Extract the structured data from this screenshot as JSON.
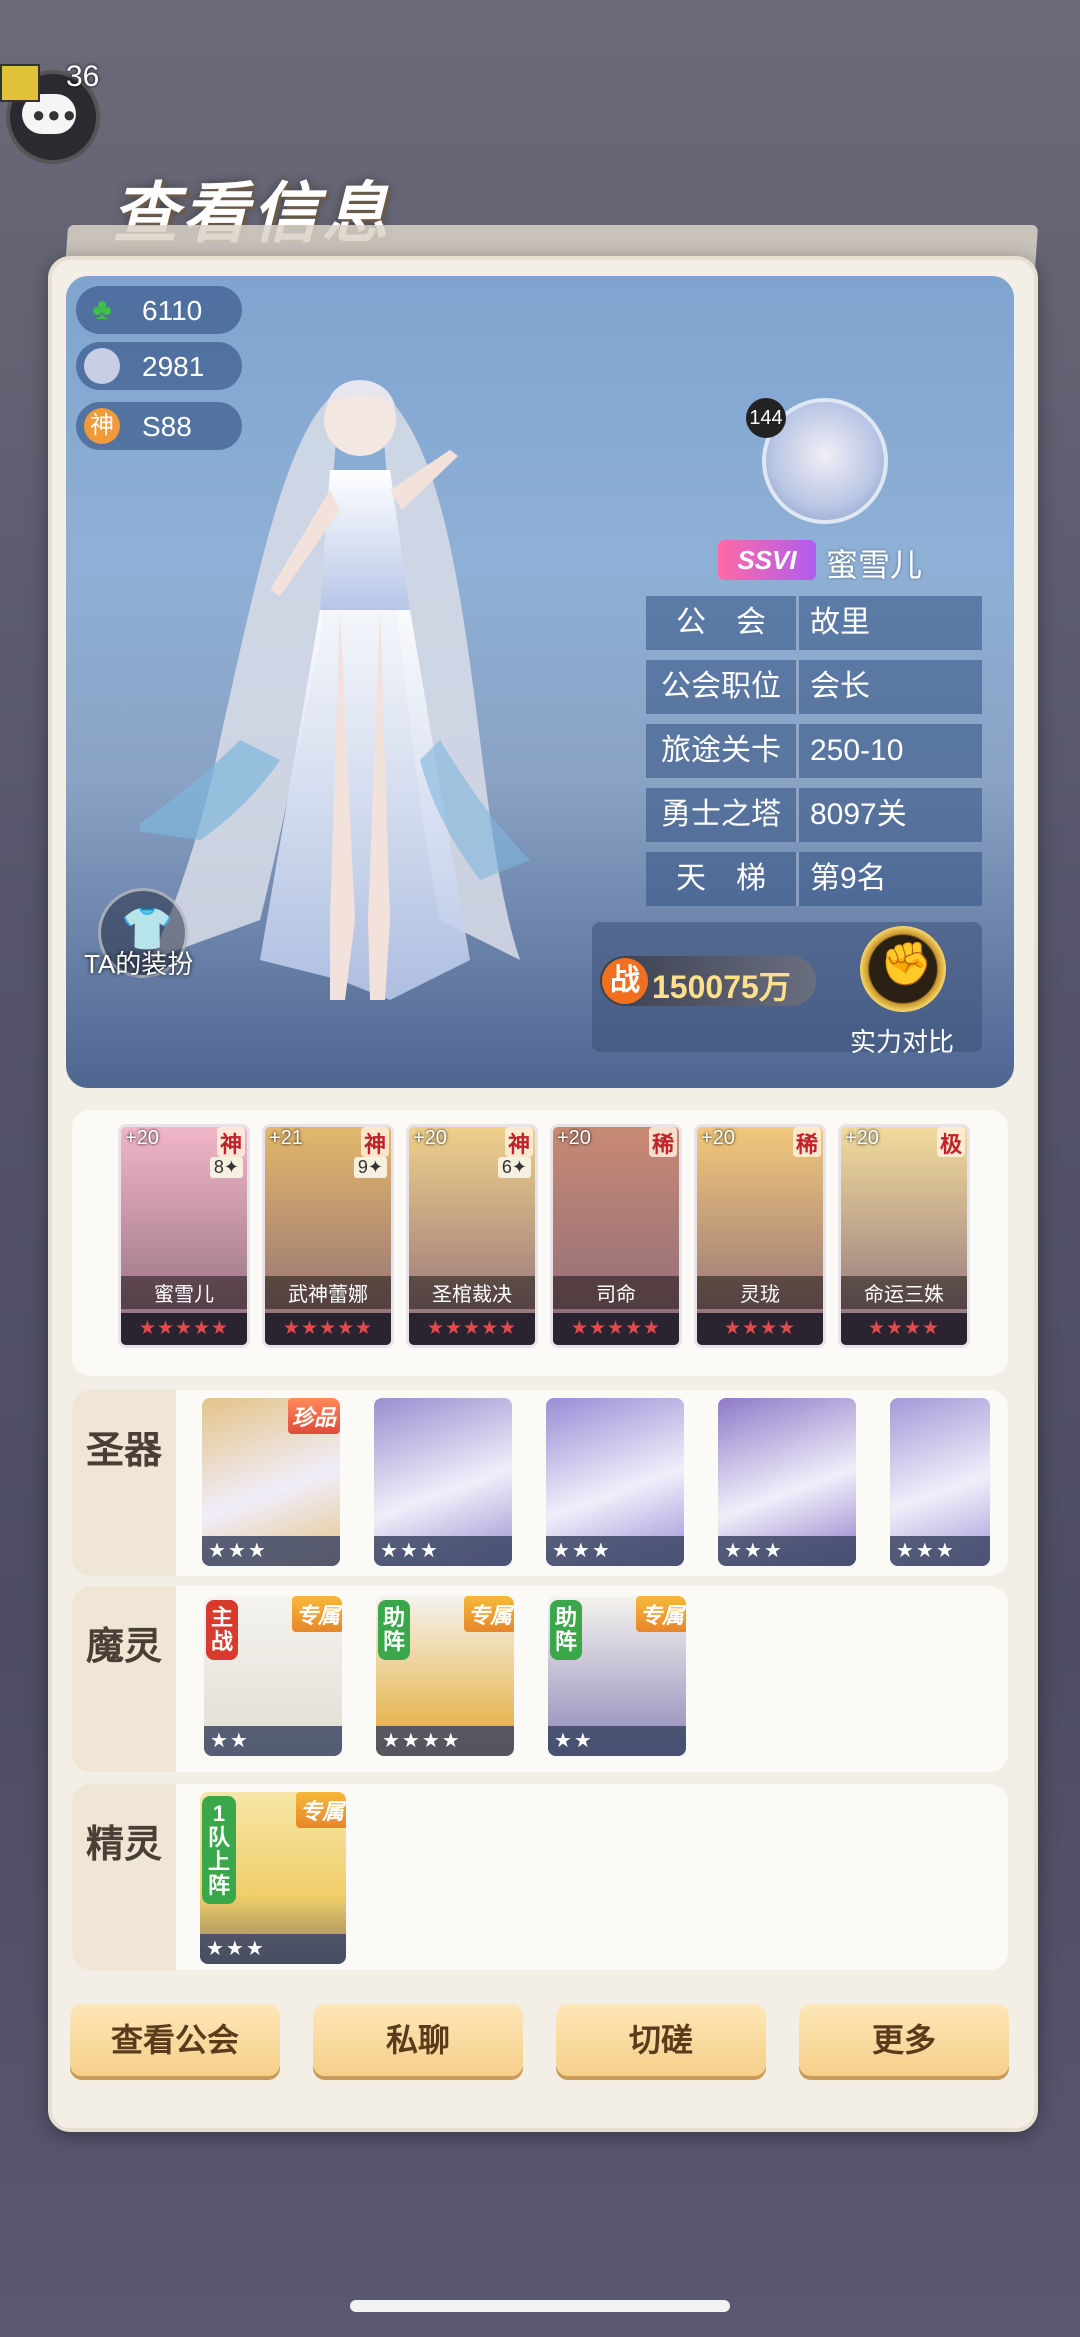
{
  "header": {
    "title": "查看信息",
    "chat_count": "36"
  },
  "stats": [
    {
      "icon": "clover-icon",
      "value": "6110",
      "color": "#3fbf4a"
    },
    {
      "icon": "crown-icon",
      "value": "2981",
      "color": "#bfc8e0"
    },
    {
      "icon": "god-icon",
      "label": "神",
      "value": "S88",
      "color": "#f09a3a"
    }
  ],
  "profile": {
    "level": "144",
    "vip": "SSVI",
    "name": "蜜雪儿",
    "info": [
      {
        "key": "公　会",
        "value": "故里"
      },
      {
        "key": "公会职位",
        "value": "会长"
      },
      {
        "key": "旅途关卡",
        "value": "250-10"
      },
      {
        "key": "勇士之塔",
        "value": "8097关"
      },
      {
        "key": "天　梯",
        "value": "第9名"
      }
    ],
    "outfit_label": "TA的装扮",
    "power_icon": "战",
    "power_value": "150075万",
    "compare_label": "实力对比"
  },
  "heroes": [
    {
      "level": "+20",
      "tag": "神",
      "star_count": "8✦",
      "name": "蜜雪儿",
      "stars": "★★★★★",
      "color": "#f2b6c8"
    },
    {
      "level": "+21",
      "tag": "神",
      "star_count": "9✦",
      "name": "武神蕾娜",
      "stars": "★★★★★",
      "color": "#e3b76a"
    },
    {
      "level": "+20",
      "tag": "神",
      "star_count": "6✦",
      "name": "圣棺裁决",
      "stars": "★★★★★",
      "color": "#f0d08a"
    },
    {
      "level": "+20",
      "tag": "稀",
      "star_count": "",
      "name": "司命",
      "stars": "★★★★★",
      "color": "#c88a74"
    },
    {
      "level": "+20",
      "tag": "稀",
      "star_count": "",
      "name": "灵珑",
      "stars": "★★★★",
      "color": "#f2c87a"
    },
    {
      "level": "+20",
      "tag": "极",
      "star_count": "",
      "name": "命运三姝",
      "stars": "★★★★",
      "color": "#f1dc9c"
    }
  ],
  "sections": {
    "artifacts_label": "圣器",
    "demons_label": "魔灵",
    "spirits_label": "精灵"
  },
  "artifacts": [
    {
      "name": "harp",
      "stars": "★★★",
      "badge": "珍品",
      "color": "#e3c387"
    },
    {
      "name": "chalice",
      "stars": "★★★",
      "badge": "",
      "color": "#9a8ed0"
    },
    {
      "name": "spear",
      "stars": "★★★",
      "badge": "",
      "color": "#9b8cd6"
    },
    {
      "name": "blade",
      "stars": "★★★",
      "badge": "",
      "color": "#8e7ac8"
    },
    {
      "name": "wing",
      "stars": "★★★",
      "badge": "",
      "color": "#a598d8"
    }
  ],
  "demons": [
    {
      "badge": "主战",
      "excl": "专属",
      "stars": "★★",
      "color": "#e0ddd4"
    },
    {
      "badge": "助阵",
      "excl": "专属",
      "stars": "★★★★",
      "color": "#e3a82c"
    },
    {
      "badge": "助阵",
      "excl": "专属",
      "stars": "★★",
      "color": "#8d86b8"
    }
  ],
  "spirits": [
    {
      "badge": "1队上阵",
      "excl": "专属",
      "stars": "★★★",
      "color": "#f0cf6a"
    }
  ],
  "buttons": {
    "view_guild": "查看公会",
    "private_chat": "私聊",
    "duel": "切磋",
    "more": "更多"
  }
}
